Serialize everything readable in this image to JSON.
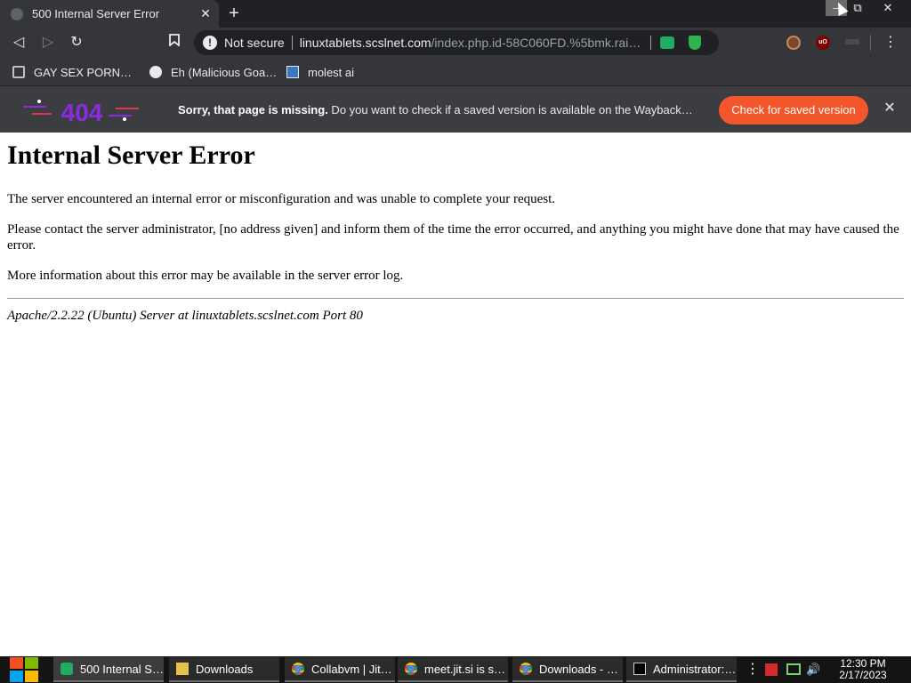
{
  "browser": {
    "tab": {
      "title": "500 Internal Server Error",
      "close": "✕"
    },
    "new_tab": "+",
    "window_controls": {
      "minimize": "–",
      "maximize": "⧉",
      "close": "✕"
    },
    "toolbar": {
      "back": "◁",
      "forward": "▷",
      "reload": "↻",
      "security_label": "Not secure",
      "warning_glyph": "!",
      "url_host": "linuxtablets.scslnet.com",
      "url_rest": "/index.php.id-58C060FD.%5bmk.rai…",
      "bookmark_glyph": "🔖",
      "ublock_label": "uO",
      "menu": "⋮"
    },
    "bookmarks": [
      {
        "label": "GAY SEX PORN…"
      },
      {
        "label": "Eh (Malicious Goa…"
      },
      {
        "label": "molest ai"
      }
    ]
  },
  "banner": {
    "logo_text": "404",
    "bold_text": "Sorry, that page is missing.",
    "text": " Do you want to check if a saved version is available on the Wayback…",
    "button_label": "Check for saved version",
    "close": "✕"
  },
  "page": {
    "heading": "Internal Server Error",
    "paragraph_1": "The server encountered an internal error or misconfiguration and was unable to complete your request.",
    "paragraph_2": "Please contact the server administrator, [no address given] and inform them of the time the error occurred, and anything you might have done that may have caused the error.",
    "paragraph_3": "More information about this error may be available in the server error log.",
    "signature": "Apache/2.2.22 (Ubuntu) Server at linuxtablets.scslnet.com Port 80"
  },
  "taskbar": {
    "items": [
      {
        "label": "500 Internal S…",
        "icon": "green-app-icon"
      },
      {
        "label": "Downloads",
        "icon": "folder-icon"
      },
      {
        "label": "Collabvm | Jit…",
        "icon": "chrome-icon"
      },
      {
        "label": "meet.jit.si is s…",
        "icon": "chrome-icon"
      },
      {
        "label": "Downloads - …",
        "icon": "chrome-icon"
      },
      {
        "label": "Administrator:…",
        "icon": "cmd-icon"
      }
    ],
    "tray_overflow": "⋮",
    "volume_glyph": "🔊",
    "time": "12:30 PM",
    "date": "2/17/2023"
  },
  "colors": {
    "chrome_dark": "#202124",
    "chrome_toolbar": "#35363a",
    "banner_bg": "#3c3d41",
    "wayback_button": "#f4562b",
    "logo_purple": "#8a2be2",
    "logo_red": "#e8334a"
  }
}
